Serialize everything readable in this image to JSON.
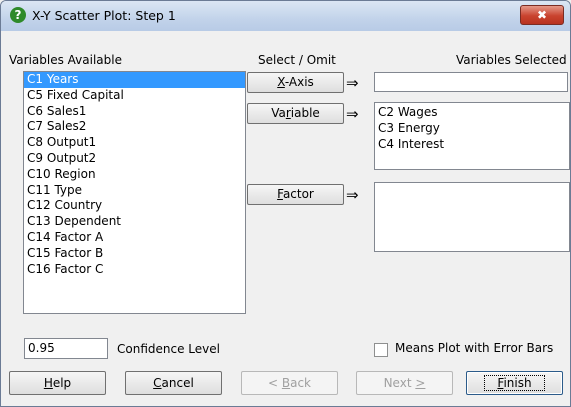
{
  "window": {
    "title": "X-Y Scatter Plot: Step 1",
    "close_icon": "✖"
  },
  "available": {
    "label": "Variables Available",
    "items": [
      "C1 Years",
      "C5 Fixed Capital",
      "C6 Sales1",
      "C7 Sales2",
      "C8 Output1",
      "C9 Output2",
      "C10 Region",
      "C11 Type",
      "C12 Country",
      "C13 Dependent",
      "C14 Factor A",
      "C15 Factor B",
      "C16 Factor C"
    ],
    "selected_index": 0
  },
  "select_omit_label": "Select / Omit",
  "selected_label": "Variables Selected",
  "xaxis": {
    "button": {
      "u": "X",
      "rest": "-Axis"
    },
    "value": ""
  },
  "variable": {
    "button": {
      "pre": "Va",
      "u": "r",
      "rest": "iable"
    },
    "items": [
      "C2 Wages",
      "C3 Energy",
      "C4 Interest"
    ]
  },
  "factor": {
    "button": {
      "u": "F",
      "rest": "actor"
    },
    "items": []
  },
  "arrow": "⇒",
  "confidence": {
    "value": "0.95",
    "label": "Confidence Level"
  },
  "means_plot": {
    "label": "Means Plot with Error Bars",
    "checked": false
  },
  "footer": {
    "help": {
      "u": "H",
      "rest": "elp"
    },
    "cancel": {
      "u": "C",
      "rest": "ancel"
    },
    "back": {
      "pre": "< ",
      "u": "B",
      "rest": "ack"
    },
    "next": {
      "pre": "Next ",
      "u": ">",
      "rest": ""
    },
    "finish": {
      "u": "F",
      "rest": "inish"
    }
  }
}
